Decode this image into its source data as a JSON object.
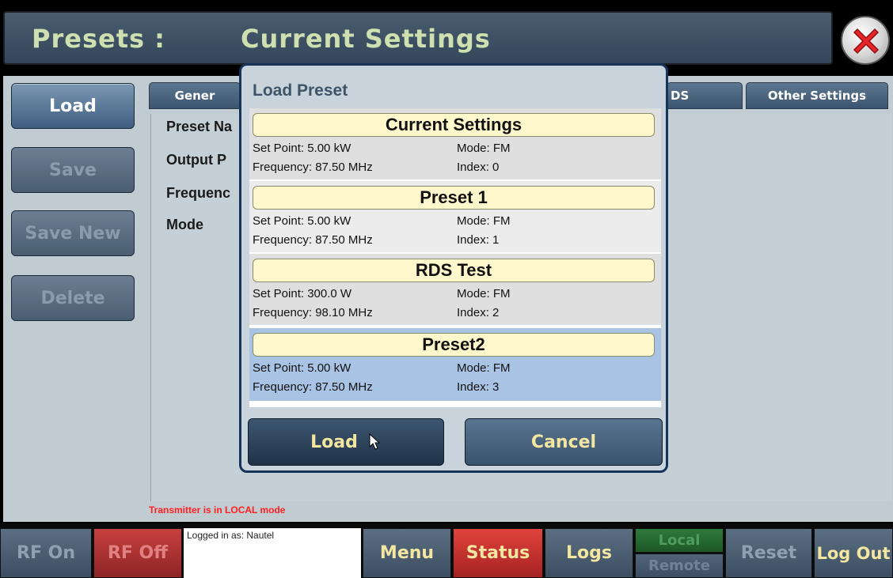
{
  "header": {
    "title_prefix": "Presets :",
    "title_page": "Current Settings"
  },
  "sidebar": {
    "buttons": [
      {
        "label": "Load"
      },
      {
        "label": "Save"
      },
      {
        "label": "Save New"
      },
      {
        "label": "Delete"
      }
    ]
  },
  "tabs": [
    {
      "label": "Gener"
    },
    {
      "label": "DS"
    },
    {
      "label": "Other Settings"
    }
  ],
  "fields": [
    {
      "label": "Preset Na"
    },
    {
      "label": "Output P"
    },
    {
      "label": "Frequenc"
    },
    {
      "label": "Mode"
    }
  ],
  "status_message": "Transmitter is in LOCAL mode",
  "modal": {
    "title": "Load Preset",
    "presets": [
      {
        "name": "Current Settings",
        "set_point": "Set Point: 5.00 kW",
        "frequency": "Frequency: 87.50 MHz",
        "mode": "Mode: FM",
        "index": "Index: 0"
      },
      {
        "name": "Preset 1",
        "set_point": "Set Point: 5.00 kW",
        "frequency": "Frequency: 87.50 MHz",
        "mode": "Mode: FM",
        "index": "Index: 1"
      },
      {
        "name": "RDS Test",
        "set_point": "Set Point: 300.0 W",
        "frequency": "Frequency: 98.10 MHz",
        "mode": "Mode: FM",
        "index": "Index: 2"
      },
      {
        "name": "Preset2",
        "set_point": "Set Point: 5.00 kW",
        "frequency": "Frequency: 87.50 MHz",
        "mode": "Mode: FM",
        "index": "Index: 3"
      }
    ],
    "load_label": "Load",
    "cancel_label": "Cancel"
  },
  "bottombar": {
    "rf_on": "RF On",
    "rf_off": "RF Off",
    "login": "Logged in as: Nautel",
    "menu": "Menu",
    "status": "Status",
    "logs": "Logs",
    "local": "Local",
    "remote": "Remote",
    "reset": "Reset",
    "logout": "Log Out"
  }
}
